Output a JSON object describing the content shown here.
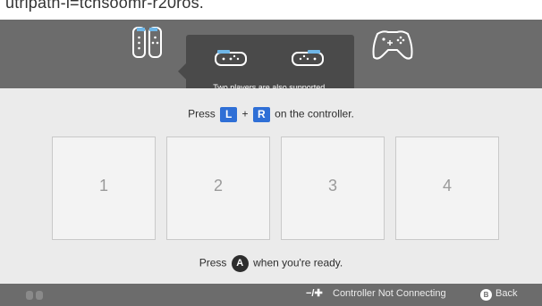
{
  "top_caption": "utripath-i=tchsoomr-r20ros.",
  "header": {
    "icons": [
      "joycon-pair-icon",
      "joycon-sideways-left-icon",
      "joycon-sideways-right-icon",
      "pro-controller-icon"
    ],
    "tooltip": "Two players are also supported."
  },
  "instruction": {
    "prefix": "Press",
    "key_l": "L",
    "plus": "+",
    "key_r": "R",
    "suffix": "on the controller."
  },
  "slots": [
    "1",
    "2",
    "3",
    "4"
  ],
  "ready": {
    "prefix": "Press",
    "button": "A",
    "suffix": "when you're ready."
  },
  "footer": {
    "left_icon": "controller-buttons-icon",
    "minus_plus": "−/✚",
    "controller_status": "Controller Not Connecting",
    "back_button": "B",
    "back_label": "Back"
  },
  "colors": {
    "header_bg": "#6c6c6c",
    "tooltip_bg": "#4a4a4a",
    "key_blue": "#2f6fd6",
    "main_bg": "#ebebeb"
  }
}
